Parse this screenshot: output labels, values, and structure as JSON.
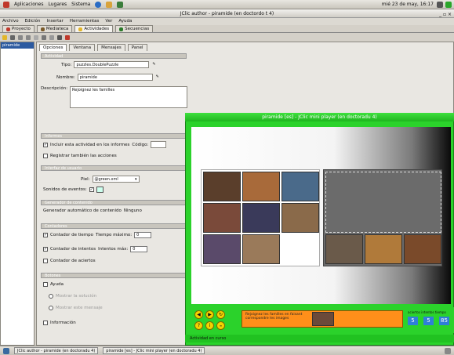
{
  "top_panel": {
    "menus": [
      "Aplicaciones",
      "Lugares",
      "Sistema"
    ],
    "clock": "mié 23 de may, 16:17"
  },
  "window": {
    "title": "JClic author - piramide (en doctordo t 4)",
    "controls": "_ ▫ ×"
  },
  "menubar": [
    "Archivo",
    "Edición",
    "Insertar",
    "Herramientas",
    "Ver",
    "Ayuda"
  ],
  "main_tabs": [
    "Proyecto",
    "Mediateca",
    "Actividades",
    "Secuencias"
  ],
  "active_main_tab": "Actividades",
  "activity_list": [
    "piramide"
  ],
  "editor_tabs": [
    "Opciones",
    "Ventana",
    "Mensajes",
    "Panel"
  ],
  "form": {
    "general_section": "Actividad",
    "tipo_label": "Tipo:",
    "tipo_value": "puzzles.DoublePuzzle",
    "nombre_label": "Nombre:",
    "nombre_value": "piramide",
    "descripcion_label": "Descripción:",
    "descripcion_value": "Rejoignez les familles",
    "informes_section": "Informes",
    "incluir_label": "Incluir esta actividad en los informes",
    "codigo_label": "Código:",
    "registrar_label": "Registrar también las acciones",
    "interfaz_section": "Interfaz de usuario",
    "skin_label": "Piel:",
    "skin_value": "@green.xml",
    "sonidos_label": "Sonidos de eventos:",
    "generador_section": "Generador de contenido",
    "generador_label": "Generador automático de contenido",
    "generador_value": "Ninguno",
    "contadores_section": "Contadores",
    "tiempo_label": "Contador de tiempo",
    "tiempo_max_label": "Tiempo máximo:",
    "tiempo_max_value": "0",
    "intentos_label": "Contador de intentos",
    "intentos_max_label": "Intentos máx:",
    "intentos_max_value": "0",
    "aciertos_label": "Contador de aciertos",
    "botones_section": "Botones",
    "ayuda_label": "Ayuda",
    "mostrar_solucion_label": "Mostrar la solución",
    "mostrar_mensaje_label": "Mostrar este mensaje",
    "informacion_label": "Información"
  },
  "player": {
    "title": "piramide [es] - JClic mini player (en doctoradu 4)",
    "message": "Rejoignez les familles en faisant correspondre les images",
    "counters": [
      5,
      5,
      85
    ],
    "counter_labels": "aciertos  intentos  tiempo",
    "status": "Actividad en curso"
  },
  "taskbar": [
    "JClic author - piramide (en doctoradu 4)",
    "piramide [es] - JClic mini player (en doctoradu 4)"
  ]
}
